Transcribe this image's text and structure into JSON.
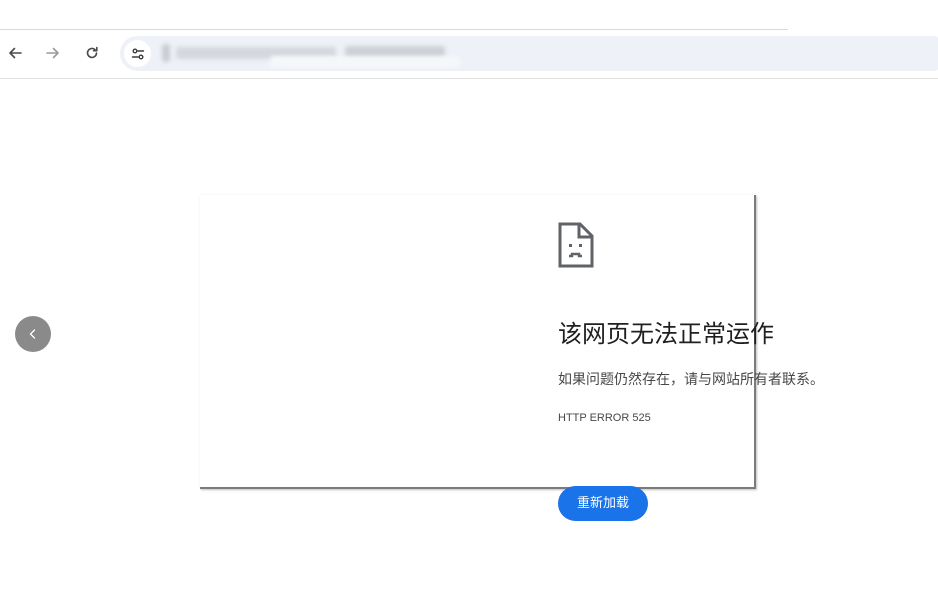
{
  "browser": {
    "url": "",
    "back_icon": "arrow-left-icon",
    "forward_icon": "arrow-right-icon",
    "reload_icon": "reload-icon",
    "site_info_icon": "tune-icon"
  },
  "carousel": {
    "prev_icon": "chevron-left-icon"
  },
  "error_page": {
    "icon": "sad-document-icon",
    "title": "该网页无法正常运作",
    "message": "如果问题仍然存在，请与网站所有者联系。",
    "code": "HTTP ERROR 525",
    "reload_label": "重新加载"
  },
  "colors": {
    "accent": "#1a73e8",
    "omnibox_bg": "#eef1f8"
  }
}
